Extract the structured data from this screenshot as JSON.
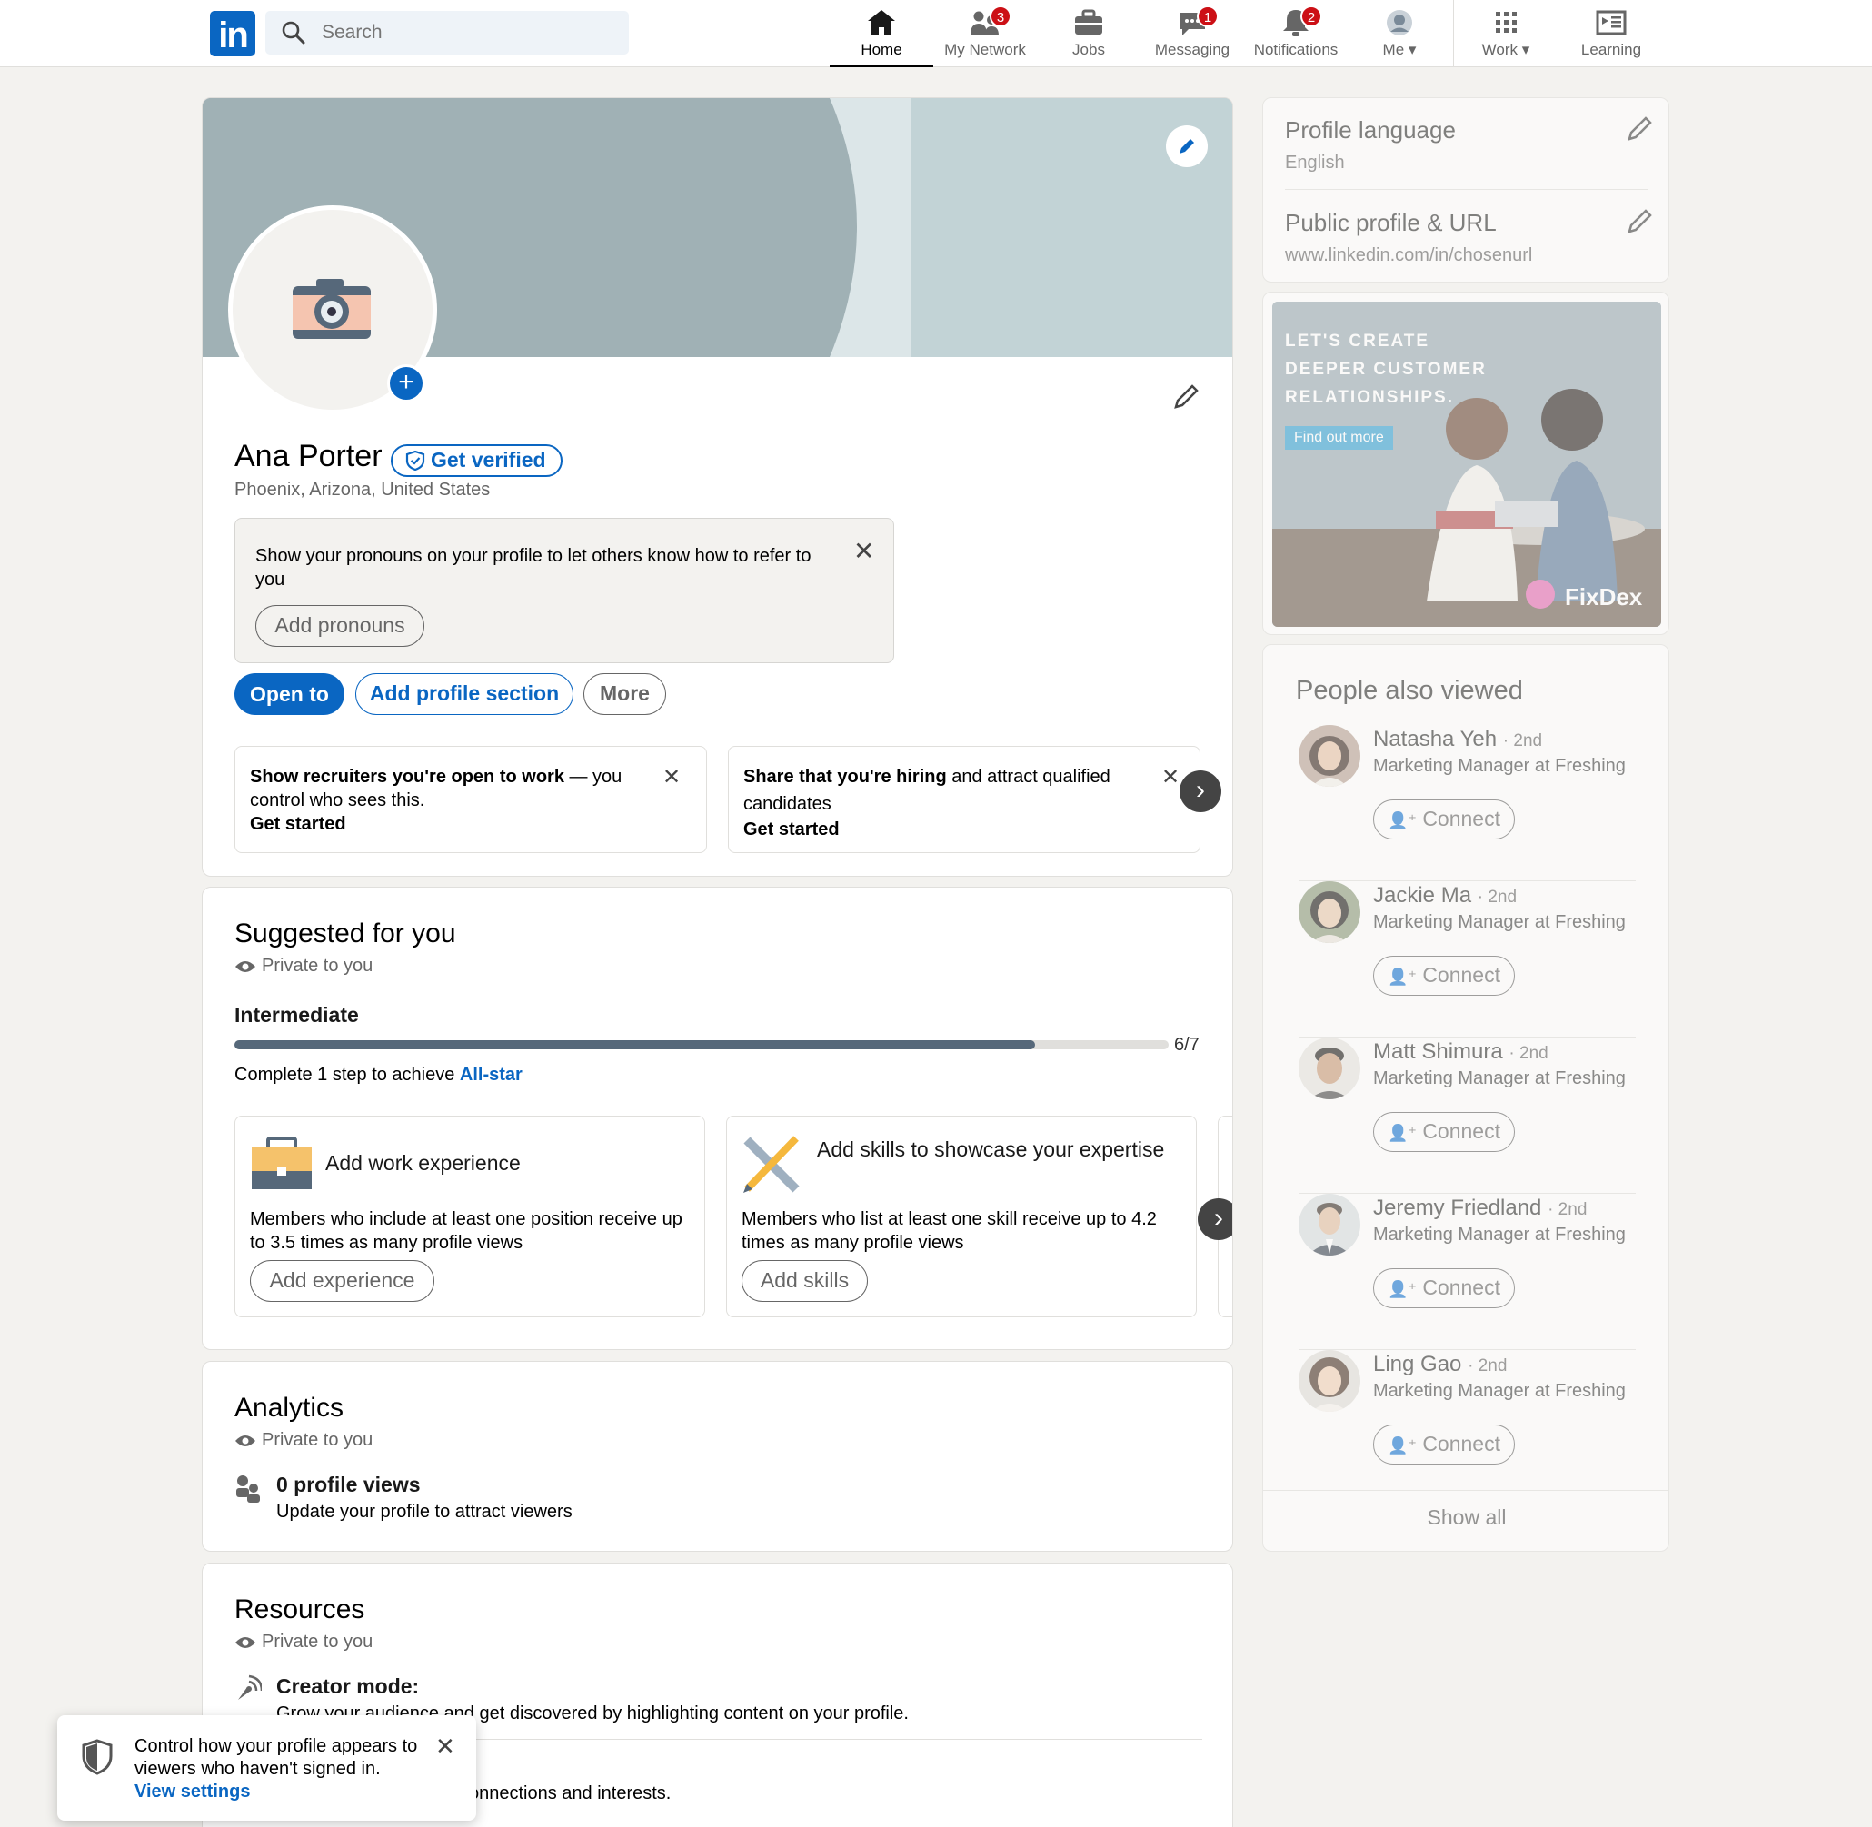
{
  "nav": {
    "search_placeholder": "Search",
    "items": [
      {
        "label": "Home",
        "badge": ""
      },
      {
        "label": "My Network",
        "badge": "3"
      },
      {
        "label": "Jobs",
        "badge": ""
      },
      {
        "label": "Messaging",
        "badge": "1"
      },
      {
        "label": "Notifications",
        "badge": "2"
      },
      {
        "label": "Me",
        "badge": ""
      },
      {
        "label": "Work",
        "badge": ""
      },
      {
        "label": "Learning",
        "badge": ""
      }
    ]
  },
  "profile": {
    "name": "Ana Porter",
    "verify_label": "Get verified",
    "location": "Phoenix, Arizona, United States",
    "pronouns_prompt": "Show your pronouns on your profile to let others know how to refer to you",
    "add_pronouns": "Add pronouns",
    "open_to": "Open to",
    "add_section": "Add profile section",
    "more": "More",
    "card1_bold": "Show recruiters you're open to work",
    "card1_rest": " — you control who sees this.",
    "card1_link": "Get started",
    "card2_bold": "Share that you're hiring",
    "card2_rest": " and attract qualified candidates",
    "card2_link": "Get started"
  },
  "suggested": {
    "title": "Suggested for you",
    "private": "Private to you",
    "level": "Intermediate",
    "progress": 0.857,
    "progress_label": "6/7",
    "step_text": "Complete 1 step to achieve ",
    "step_link": "All-star",
    "cards": [
      {
        "title": "Add work experience",
        "desc": "Members who include at least one position receive up to 3.5 times as many profile views",
        "button": "Add experience"
      },
      {
        "title": "Add skills to showcase your expertise",
        "desc": "Members who list at least one skill receive up to 4.2 times as many profile views",
        "button": "Add skills"
      }
    ]
  },
  "analytics": {
    "title": "Analytics",
    "private": "Private to you",
    "views": "0 profile views",
    "views_sub": "Update your profile to attract viewers"
  },
  "resources": {
    "title": "Resources",
    "private": "Private to you",
    "creator_title": "Creator mode:",
    "creator_desc": "Grow your audience and get discovered by highlighting content on your profile.",
    "second_desc": "onnections and interests."
  },
  "toast": {
    "text": "Control how your profile appears to viewers who haven't signed in.",
    "link": "View settings"
  },
  "sidebar": {
    "lang_title": "Profile language",
    "lang_value": "English",
    "url_title": "Public profile & URL",
    "url_value": "www.linkedin.com/in/chosenurl",
    "ad_headline": "LET'S CREATE DEEPER CUSTOMER RELATIONSHIPS.",
    "ad_button": "Find out more",
    "ad_brand": "FixDex",
    "pav_title": "People also viewed",
    "people": [
      {
        "name": "Natasha Yeh",
        "degree": "· 2nd",
        "title": "Marketing Manager at Freshing",
        "connect": "Connect"
      },
      {
        "name": "Jackie Ma",
        "degree": "· 2nd",
        "title": "Marketing Manager at Freshing",
        "connect": "Connect"
      },
      {
        "name": "Matt Shimura",
        "degree": "· 2nd",
        "title": "Marketing Manager at Freshing",
        "connect": "Connect"
      },
      {
        "name": "Jeremy Friedland",
        "degree": "· 2nd",
        "title": "Marketing Manager at Freshing",
        "connect": "Connect"
      },
      {
        "name": "Ling Gao",
        "degree": "· 2nd",
        "title": "Marketing Manager at Freshing",
        "connect": "Connect"
      }
    ],
    "show_all": "Show all"
  },
  "colors": {
    "brand": "#0a66c2",
    "badge": "#cc1016",
    "banner": "#a0b1b5",
    "background": "#f3f2ef"
  }
}
